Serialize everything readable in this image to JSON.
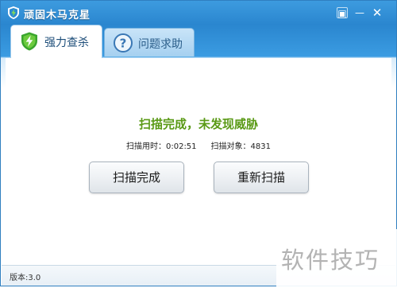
{
  "window": {
    "title": "顽固木马克星"
  },
  "title_buttons": [
    {
      "name": "settings",
      "glyph": "▣"
    },
    {
      "name": "minimize",
      "glyph": "—"
    },
    {
      "name": "close",
      "glyph": "✕"
    }
  ],
  "tabs": [
    {
      "label": "强力查杀",
      "icon": "shield-lightning-icon",
      "active": true
    },
    {
      "label": "问题求助",
      "icon": "question-icon",
      "active": false
    }
  ],
  "main": {
    "status": "扫描完成，未发现威胁",
    "scan_time_label": "扫描用时：",
    "scan_time": "0:02:51",
    "scan_objects_label": "扫描对象：",
    "scan_objects": "4831",
    "finish_button": "扫描完成",
    "rescan_button": "重新扫描"
  },
  "footer": {
    "version": "版本:3.0"
  },
  "watermark": "软件技巧",
  "colors": {
    "titlebar": "#2a86cf",
    "status_green": "#5a9a16",
    "tab_text": "#1e4e7a"
  }
}
